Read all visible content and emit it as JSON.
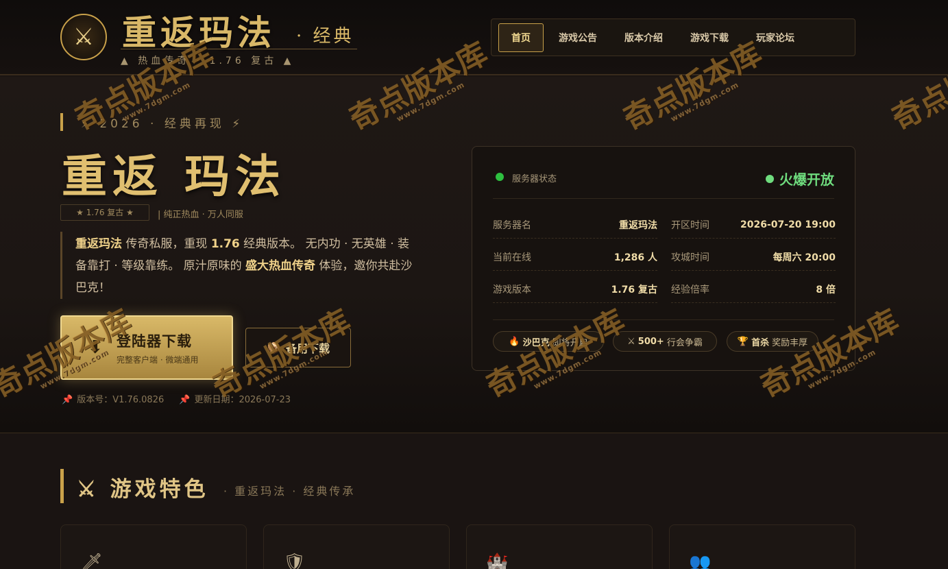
{
  "header": {
    "logo_icon": "crossed-swords-icon",
    "brand_title": "重返玛法",
    "brand_sub": "· 经典",
    "brand_tag": "▲ 热血传奇 · 1.76 复古 ▲",
    "nav": [
      {
        "label": "首页",
        "active": true
      },
      {
        "label": "游戏公告",
        "active": false
      },
      {
        "label": "版本介绍",
        "active": false
      },
      {
        "label": "游戏下载",
        "active": false
      },
      {
        "label": "玩家论坛",
        "active": false
      }
    ]
  },
  "hero": {
    "eyebrow": "⚡ 2026 · 经典再现 ⚡",
    "title": "重返 玛法",
    "badge_version": "★ 1.76 复古 ★",
    "badge_slogan": "| 纯正热血 · 万人同服",
    "desc": {
      "p1_bold": "重返玛法",
      "p1": " 传奇私服，重现 ",
      "p2_bold": "1.76",
      "p2": " 经典版本。 无内功 · 无英雄 · 装备靠打 · 等级靠练。 原汁原味的 ",
      "p3_bold": "盛大热血传奇",
      "p3": " 体验，邀你共赴沙巴克！"
    },
    "btn_primary_main": "登陆器下载",
    "btn_primary_sub": "完整客户端 · 微端通用",
    "btn_secondary": "备用下载",
    "version_label": "版本号：V1.76.0826",
    "update_label": "更新日期：2026-07-23"
  },
  "status_card": {
    "head_label": "服务器状态",
    "state": "火爆开放",
    "state_color": "#6fdc7e",
    "rows": [
      {
        "k1": "服务器名",
        "v1": "重返玛法",
        "k2": "开区时间",
        "v2": "2026-07-20 19:00"
      },
      {
        "k1": "当前在线",
        "v1": "1,286 人",
        "k2": "攻城时间",
        "v2": "每周六 20:00"
      },
      {
        "k1": "游戏版本",
        "v1": "1.76 复古",
        "k2": "经验倍率",
        "v2": "8 倍"
      }
    ],
    "pills": [
      {
        "icon": "🔥",
        "bold": "沙巴克",
        "text": "即将开启"
      },
      {
        "icon": "⚔",
        "bold": "500+",
        "text": "行会争霸"
      },
      {
        "icon": "🏆",
        "bold": "首杀",
        "text": "奖励丰厚"
      }
    ]
  },
  "features": {
    "title": "⚔ 游戏特色",
    "sub": "· 重返玛法 · 经典传承",
    "card_icons": [
      "dagger-icon",
      "shield-icon",
      "castle-icon",
      "group-icon"
    ]
  },
  "watermark": {
    "text": "奇点版本库",
    "url": "www.7dgm.com"
  },
  "colors": {
    "accent_gold": "#c9a14a",
    "background": "#1a1412",
    "online_green": "#2ec040"
  }
}
